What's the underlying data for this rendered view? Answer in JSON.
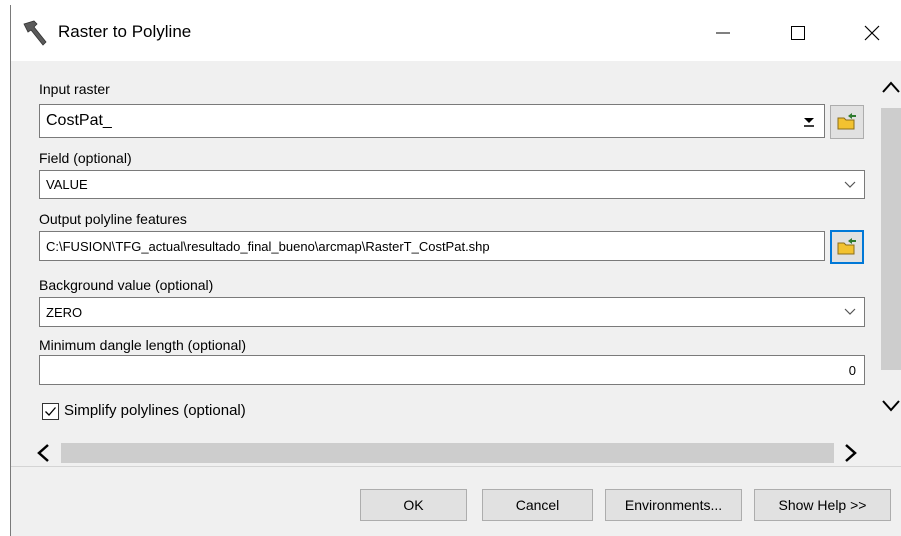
{
  "window": {
    "title": "Raster to Polyline",
    "icon": "hammer-icon"
  },
  "fields": {
    "input_raster": {
      "label": "Input raster",
      "value": "CostPat_"
    },
    "field": {
      "label": "Field (optional)",
      "value": "VALUE"
    },
    "output": {
      "label": "Output polyline features",
      "value": "C:\\FUSION\\TFG_actual\\resultado_final_bueno\\arcmap\\RasterT_CostPat.shp"
    },
    "background": {
      "label": "Background value (optional)",
      "value": "ZERO"
    },
    "dangle": {
      "label": "Minimum dangle length (optional)",
      "value": "0"
    },
    "simplify": {
      "label": "Simplify polylines (optional)",
      "checked": true
    }
  },
  "buttons": {
    "ok": "OK",
    "cancel": "Cancel",
    "environments": "Environments...",
    "show_help": "Show Help >>"
  },
  "colors": {
    "focus_border": "#0078d7",
    "folder_yellow": "#f2c230"
  }
}
